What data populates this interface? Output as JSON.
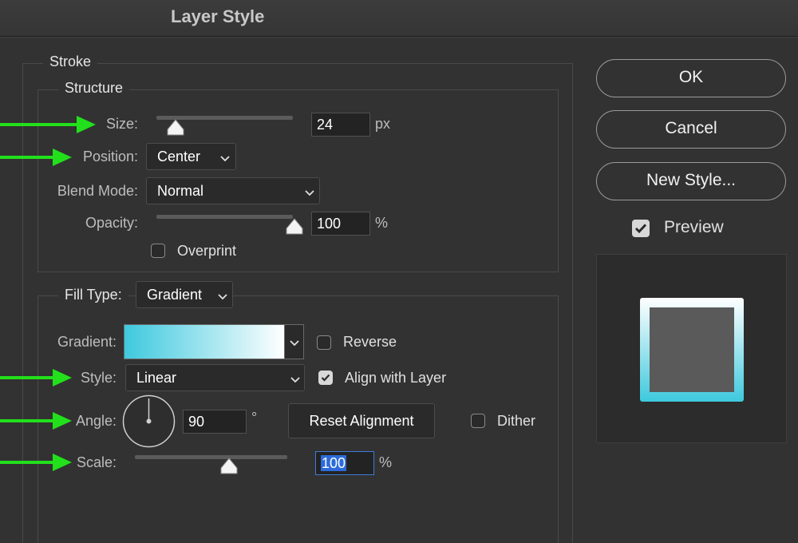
{
  "window": {
    "title": "Layer Style"
  },
  "stroke": {
    "legend": "Stroke",
    "structure": {
      "legend": "Structure",
      "size": {
        "label": "Size:",
        "value": "24",
        "unit": "px",
        "slider_fraction": 0.12
      },
      "position": {
        "label": "Position:",
        "selected": "Center"
      },
      "blend_mode": {
        "label": "Blend Mode:",
        "selected": "Normal"
      },
      "opacity": {
        "label": "Opacity:",
        "value": "100",
        "unit": "%",
        "slider_fraction": 1.0
      },
      "overprint": {
        "label": "Overprint",
        "checked": false
      }
    },
    "fill": {
      "label": "Fill Type:",
      "selected": "Gradient",
      "gradient": {
        "label": "Gradient:",
        "colors": [
          "#3ec9de",
          "#ffffff"
        ]
      },
      "reverse": {
        "label": "Reverse",
        "checked": false
      },
      "style": {
        "label": "Style:",
        "selected": "Linear"
      },
      "align_with_layer": {
        "label": "Align with Layer",
        "checked": true
      },
      "angle": {
        "label": "Angle:",
        "value": "90",
        "unit": "°"
      },
      "reset_alignment": "Reset Alignment",
      "dither": {
        "label": "Dither",
        "checked": false
      },
      "scale": {
        "label": "Scale:",
        "value": "100",
        "unit": "%",
        "slider_fraction": 0.6
      }
    }
  },
  "buttons": {
    "ok": "OK",
    "cancel": "Cancel",
    "new_style": "New Style..."
  },
  "preview": {
    "label": "Preview",
    "checked": true,
    "stroke_gradient": [
      "#ffffff",
      "#3ec9de"
    ],
    "fill_color": "#5a5a5a"
  },
  "colors": {
    "annotation_arrow": "#22e01b",
    "selection": "#2c6bd9"
  }
}
